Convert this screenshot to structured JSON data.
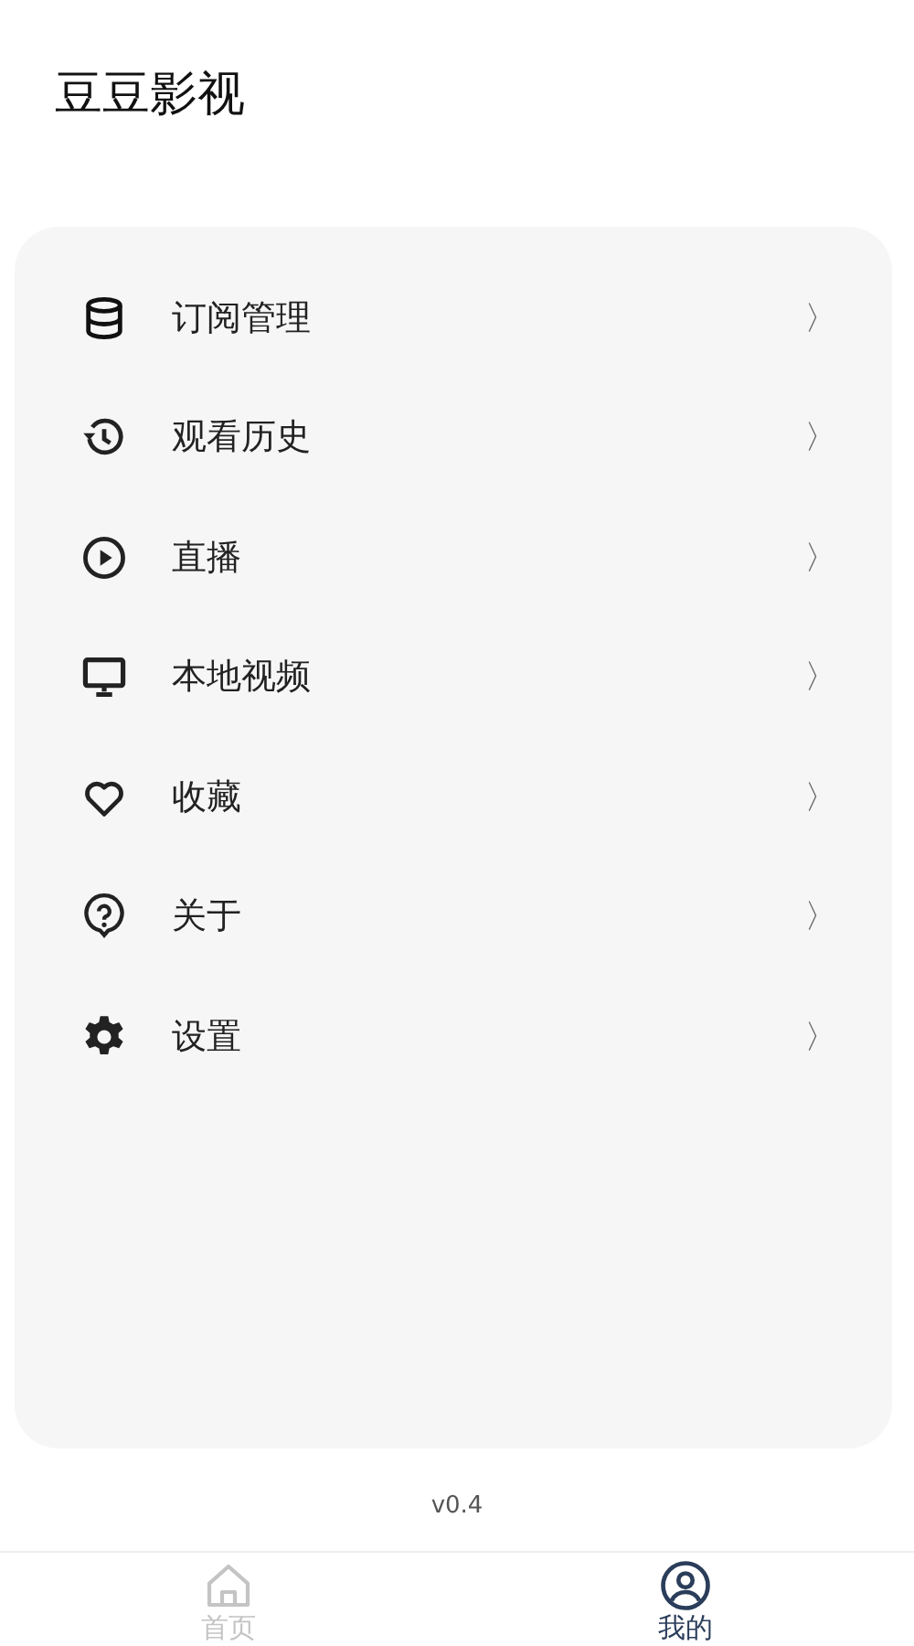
{
  "app_title": "豆豆影视",
  "menu": [
    {
      "label": "订阅管理",
      "chevron": "〉"
    },
    {
      "label": "观看历史",
      "chevron": "〉"
    },
    {
      "label": "直播",
      "chevron": "〉"
    },
    {
      "label": "本地视频",
      "chevron": "〉"
    },
    {
      "label": "收藏",
      "chevron": "〉"
    },
    {
      "label": "关于",
      "chevron": "〉"
    },
    {
      "label": "设置",
      "chevron": "〉"
    }
  ],
  "version": "v0.4",
  "tabs": [
    {
      "label": "首页",
      "selected": false
    },
    {
      "label": "我的",
      "selected": true
    }
  ]
}
